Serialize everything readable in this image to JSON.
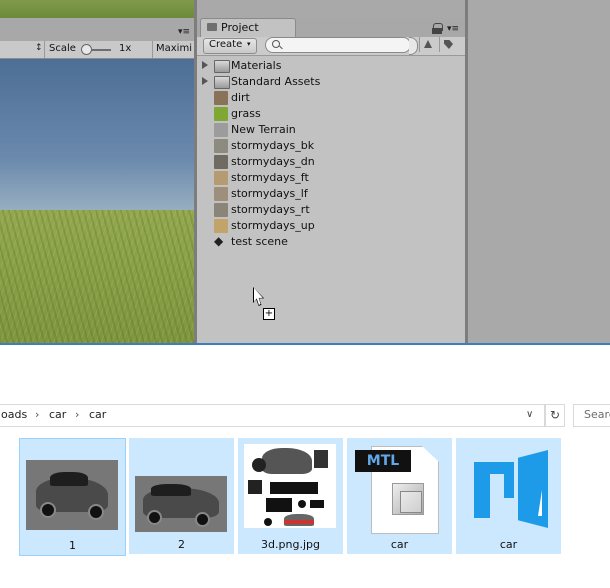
{
  "unity": {
    "game_toolbar": {
      "display_arrow": "↕",
      "scale_label": "Scale",
      "scale_value": "1x",
      "maximize_label": "Maximi"
    },
    "scene_menu_glyph": "▾≡",
    "project_panel": {
      "tab_label": "Project",
      "menu_glyph": "▾≡",
      "create_label": "Create",
      "create_arrow": "▾",
      "search_placeholder": "",
      "items": [
        {
          "label": "Materials",
          "type": "folder"
        },
        {
          "label": "Standard Assets",
          "type": "folder"
        },
        {
          "label": "dirt",
          "type": "texture",
          "color": "#8a7259"
        },
        {
          "label": "grass",
          "type": "texture",
          "color": "#7fa733"
        },
        {
          "label": "New Terrain",
          "type": "terrain",
          "color": "#9c9c9c"
        },
        {
          "label": "stormydays_bk",
          "type": "skybox",
          "color": "#8d8a80"
        },
        {
          "label": "stormydays_dn",
          "type": "skybox",
          "color": "#6f6b63"
        },
        {
          "label": "stormydays_ft",
          "type": "skybox",
          "color": "#b59b72"
        },
        {
          "label": "stormydays_lf",
          "type": "skybox",
          "color": "#9d8f7b"
        },
        {
          "label": "stormydays_rt",
          "type": "skybox",
          "color": "#8a8578"
        },
        {
          "label": "stormydays_up",
          "type": "skybox",
          "color": "#c2a36a"
        },
        {
          "label": "test scene",
          "type": "scene",
          "color": "#222222"
        }
      ],
      "drag_badge": "+"
    }
  },
  "explorer": {
    "breadcrumbs": [
      "oads",
      "car",
      "car"
    ],
    "crumb_separator": "›",
    "dropdown_glyph": "∨",
    "refresh_glyph": "↻",
    "search_placeholder": "Search",
    "files": [
      {
        "name": "1",
        "kind": "image"
      },
      {
        "name": "2",
        "kind": "image"
      },
      {
        "name": "3d.png.jpg",
        "kind": "texture"
      },
      {
        "name": "car",
        "kind": "mtl",
        "badge": "MTL"
      },
      {
        "name": "car",
        "kind": "obj"
      }
    ]
  },
  "colors": {
    "selection": "#cce8ff",
    "unity_panel": "#c2c2c2",
    "accent_blue": "#1e9be8"
  }
}
